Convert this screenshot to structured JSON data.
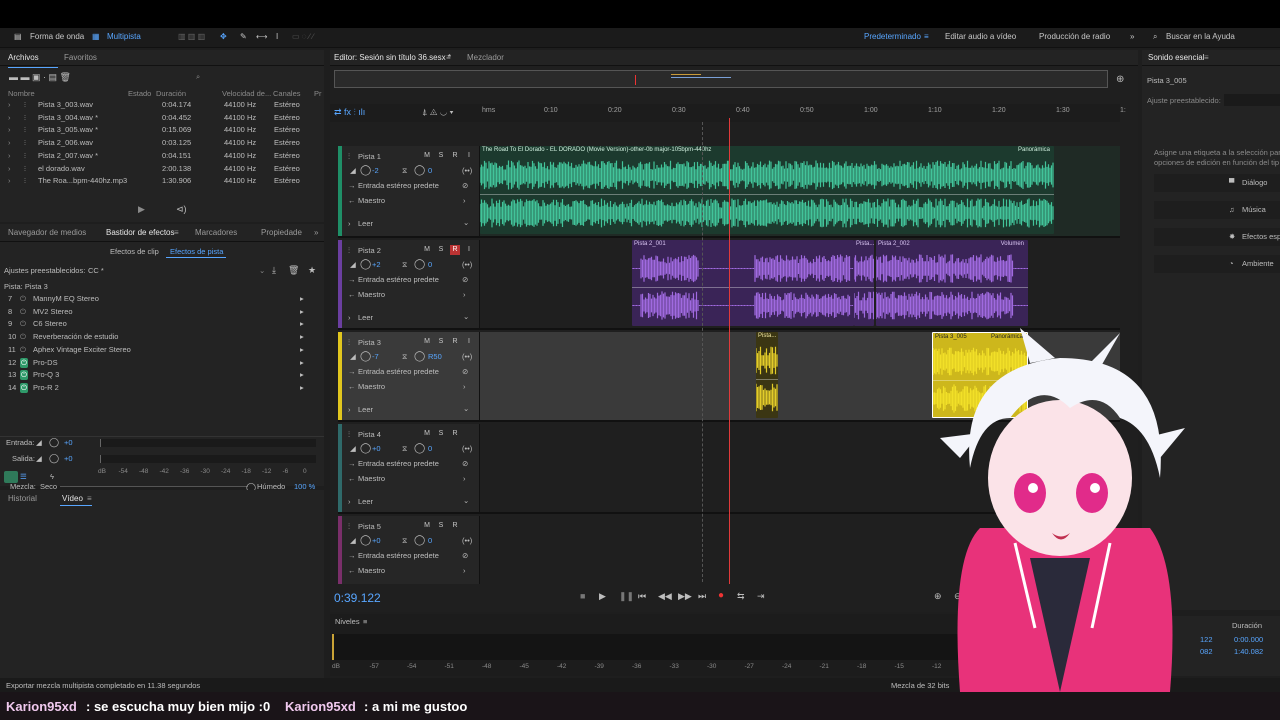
{
  "toolbar": {
    "waveform": "Forma de onda",
    "multitrack": "Multipista",
    "workspace_default": "Predeterminado",
    "workspace_video": "Editar audio a vídeo",
    "workspace_radio": "Producción de radio",
    "help_search_placeholder": "Buscar en la Ayuda"
  },
  "files_panel": {
    "tabs": [
      "Archivos",
      "Favoritos"
    ],
    "columns": [
      "Nombre",
      "Estado",
      "Duración",
      "Velocidad de...",
      "Canales",
      "Pr"
    ],
    "files": [
      {
        "name": "Pista 3_003.wav",
        "duration": "0:04.174",
        "rate": "44100 Hz",
        "channels": "Estéreo"
      },
      {
        "name": "Pista 3_004.wav *",
        "duration": "0:04.452",
        "rate": "44100 Hz",
        "channels": "Estéreo"
      },
      {
        "name": "Pista 3_005.wav *",
        "duration": "0:15.069",
        "rate": "44100 Hz",
        "channels": "Estéreo"
      },
      {
        "name": "Pista 2_006.wav",
        "duration": "0:03.125",
        "rate": "44100 Hz",
        "channels": "Estéreo"
      },
      {
        "name": "Pista 2_007.wav *",
        "duration": "0:04.151",
        "rate": "44100 Hz",
        "channels": "Estéreo"
      },
      {
        "name": "el dorado.wav",
        "duration": "2:00.138",
        "rate": "44100 Hz",
        "channels": "Estéreo"
      },
      {
        "name": "The Roa...bpm-440hz.mp3",
        "duration": "1:30.906",
        "rate": "44100 Hz",
        "channels": "Estéreo"
      }
    ]
  },
  "effects_panel": {
    "tabs": [
      "Navegador de medios",
      "Bastidor de efectos",
      "Marcadores",
      "Propiedade"
    ],
    "subtabs": [
      "Efectos de clip",
      "Efectos de pista"
    ],
    "presets_label": "Ajustes preestablecidos:",
    "presets_value": "CC *",
    "track_label": "Pista: Pista 3",
    "effects": [
      {
        "n": "7",
        "name": "MannyM EQ Stereo"
      },
      {
        "n": "8",
        "name": "MV2 Stereo"
      },
      {
        "n": "9",
        "name": "C6 Stereo"
      },
      {
        "n": "10",
        "name": "Reverberación de estudio"
      },
      {
        "n": "11",
        "name": "Aphex Vintage Exciter Stereo"
      },
      {
        "n": "12",
        "name": "Pro-DS"
      },
      {
        "n": "13",
        "name": "Pro-Q 3"
      },
      {
        "n": "14",
        "name": "Pro-R 2"
      }
    ],
    "input_label": "Entrada:",
    "input_val": "+0",
    "output_label": "Salida:",
    "output_val": "+0",
    "meter_scale": [
      "dB",
      "-54",
      "-48",
      "-42",
      "-36",
      "-30",
      "-24",
      "-18",
      "-12",
      "-6",
      "0"
    ],
    "mix_label": "Mezcla:",
    "mix_dry": "Seco",
    "mix_wet": "Húmedo",
    "mix_pct": "100 %"
  },
  "history_panel": {
    "tabs": [
      "Historial",
      "Vídeo"
    ]
  },
  "editor": {
    "tab_editor": "Editor: Sesión sin título 36.sesx *",
    "tab_mixer": "Mezclador",
    "ruler": [
      "hms",
      "0:10",
      "0:20",
      "0:30",
      "0:40",
      "0:50",
      "1:00",
      "1:10",
      "1:20",
      "1:30",
      "1:"
    ],
    "time": "0:39.122",
    "tracks": [
      {
        "name": "Pista 1",
        "vol": "-2",
        "pan": "0",
        "input": "Entrada estéreo predete",
        "output": "Maestro",
        "mode": "Leer",
        "clips": [
          {
            "label": "The Road To El Dorado - EL DORADO (Movie Version)-other-0b major-105bpm-440hz",
            "extra": "Panorámica"
          }
        ]
      },
      {
        "name": "Pista 2",
        "vol": "+2",
        "pan": "0",
        "input": "Entrada estéreo predete",
        "output": "Maestro",
        "mode": "Leer",
        "clips": [
          {
            "label": "Pista 2_001"
          },
          {
            "label": "Pista..."
          },
          {
            "label": "Pista 2_002",
            "extra": "Volumen"
          }
        ]
      },
      {
        "name": "Pista 3",
        "vol": "-7",
        "pan": "R50",
        "input": "Entrada estéreo predete",
        "output": "Maestro",
        "mode": "Leer",
        "clips": [
          {
            "label": "Pista..."
          },
          {
            "label": "Pista 3_005",
            "extra": "Panorámica"
          }
        ]
      },
      {
        "name": "Pista 4",
        "vol": "+0",
        "pan": "0",
        "input": "Entrada estéreo predete",
        "output": "Maestro",
        "mode": "Leer",
        "clips": []
      },
      {
        "name": "Pista 5",
        "vol": "+0",
        "pan": "0",
        "input": "Entrada estéreo predete",
        "output": "Maestro",
        "mode": "Leer",
        "clips": []
      }
    ]
  },
  "levels_panel": {
    "title": "Niveles",
    "scale": [
      "dB",
      "-57",
      "-54",
      "-51",
      "-48",
      "-45",
      "-42",
      "-39",
      "-36",
      "-33",
      "-30",
      "-27",
      "-24",
      "-21",
      "-18",
      "-15",
      "-12"
    ]
  },
  "essential_sound": {
    "title": "Sonido esencial",
    "clip_name": "Pista 3_005",
    "preset_label": "Ajuste preestablecido:",
    "assign_text_1": "Asigne una etiqueta a la selección para",
    "assign_text_2": "opciones de edición en función del tip",
    "buttons": [
      "Diálogo",
      "Música",
      "Efectos esp",
      "Ambiente"
    ]
  },
  "selection_panel": {
    "col_duration": "Duración",
    "v1": "122",
    "v2": "082",
    "d1": "0:00.000",
    "d2": "1:40.082"
  },
  "status": {
    "left": "Exportar mezcla multipista completado en 11.38 segundos",
    "right": "Mezcla de 32 bits"
  },
  "chat": [
    {
      "user": "Karion95xd",
      "msg": ": se escucha muy bien mijo :0"
    },
    {
      "user": "Karion95xd",
      "msg": ": a mi me gustoo"
    }
  ],
  "colors": {
    "track1": "#3fbf8f",
    "track2": "#9a5fd6",
    "track3": "#d9c21f",
    "accent": "#58a6ff",
    "pink": "#e8327a"
  }
}
